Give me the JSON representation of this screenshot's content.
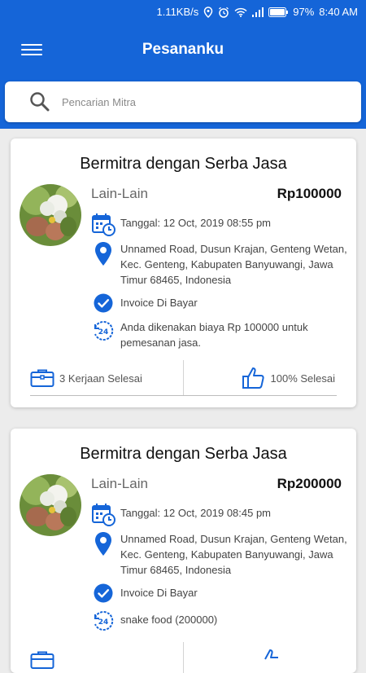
{
  "status_bar": {
    "speed": "1.11KB/s",
    "battery": "97%",
    "time": "8:40 AM"
  },
  "app_bar": {
    "title": "Pesananku"
  },
  "search": {
    "placeholder": "Pencarian Mitra"
  },
  "orders": [
    {
      "title": "Bermitra dengan Serba Jasa",
      "category": "Lain-Lain",
      "price": "Rp100000",
      "date": "Tanggal: 12 Oct, 2019 08:55 pm",
      "address": "Unnamed Road, Dusun Krajan, Genteng Wetan, Kec. Genteng, Kabupaten Banyuwangi, Jawa Timur 68465, Indonesia",
      "invoice": "Invoice Di Bayar",
      "note": "Anda dikenakan biaya Rp 100000 untuk pemesanan jasa.",
      "jobs_done": "3 Kerjaan Selesai",
      "completion": "100% Selesai"
    },
    {
      "title": "Bermitra dengan Serba Jasa",
      "category": "Lain-Lain",
      "price": "Rp200000",
      "date": "Tanggal: 12 Oct, 2019 08:45 pm",
      "address": "Unnamed Road, Dusun Krajan, Genteng Wetan, Kec. Genteng, Kabupaten Banyuwangi, Jawa Timur 68465, Indonesia",
      "invoice": "Invoice Di Bayar",
      "note": "snake food (200000)"
    }
  ],
  "colors": {
    "primary": "#1565d8",
    "background": "#ececec"
  }
}
